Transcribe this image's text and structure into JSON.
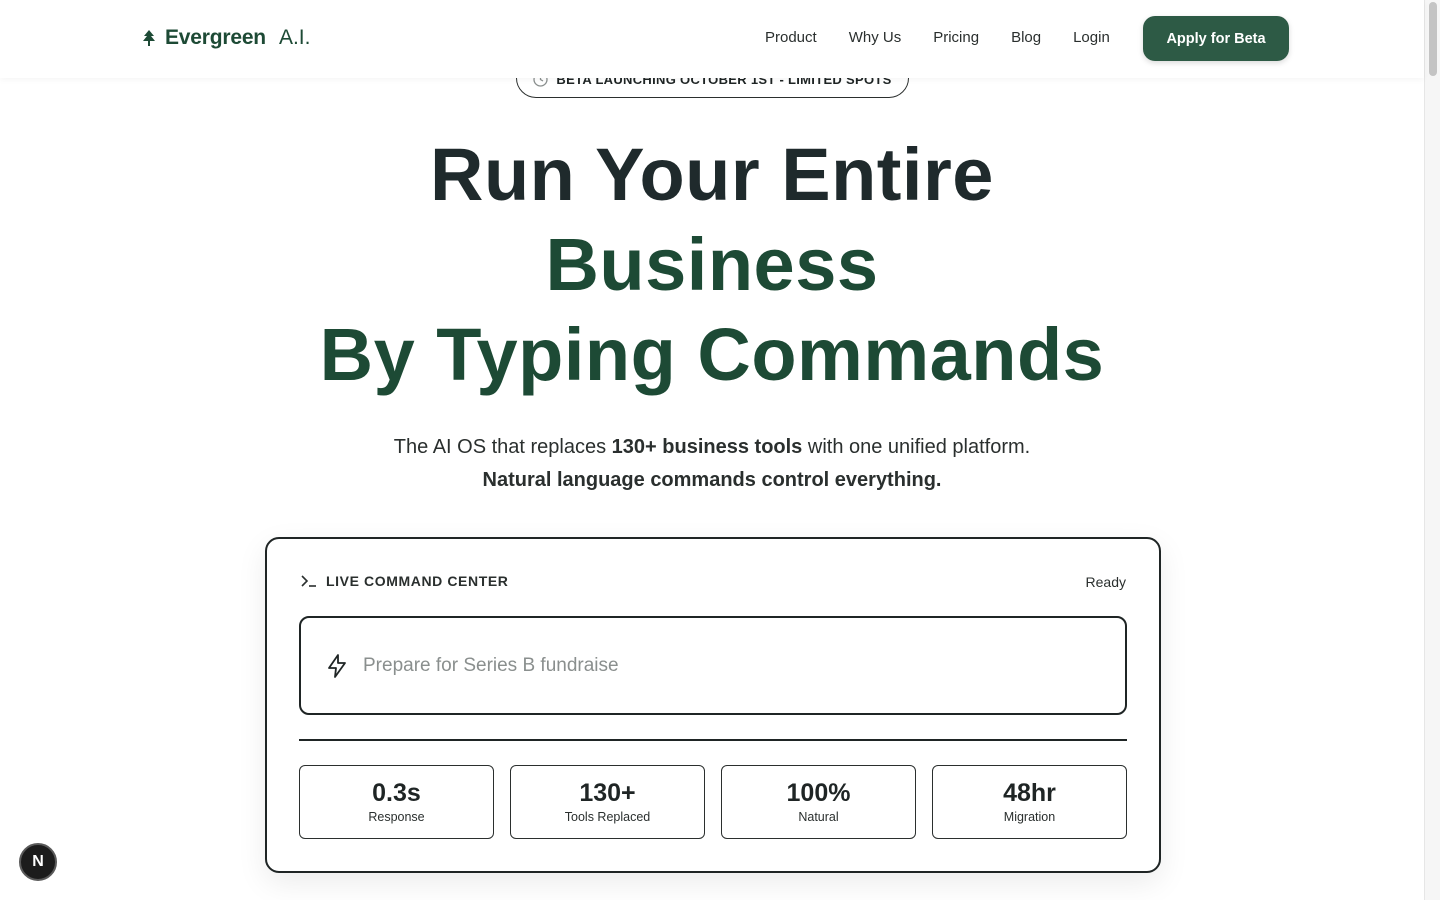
{
  "header": {
    "brand": "Evergreen",
    "brand_suffix": "A.I.",
    "nav": [
      "Product",
      "Why Us",
      "Pricing",
      "Blog",
      "Login"
    ],
    "cta": "Apply for Beta"
  },
  "beta_pill": "BETA LAUNCHING OCTOBER 1ST - LIMITED SPOTS",
  "hero": {
    "line1": "Run Your Entire",
    "line2": "Business",
    "line3": "By Typing Commands",
    "sub_prefix": "The AI OS that replaces ",
    "sub_bold": "130+ business tools",
    "sub_suffix": " with one unified platform.",
    "sub_line2": "Natural language commands control everything."
  },
  "command_center": {
    "title": "LIVE COMMAND CENTER",
    "status": "Ready",
    "placeholder": "Prepare for Series B fundraise",
    "stats": [
      {
        "value": "0.3s",
        "label": "Response"
      },
      {
        "value": "130+",
        "label": "Tools Replaced"
      },
      {
        "value": "100%",
        "label": "Natural"
      },
      {
        "value": "48hr",
        "label": "Migration"
      }
    ]
  },
  "badge": "N",
  "colors": {
    "brand_green": "#1d4a35",
    "button_green": "#2d5a45",
    "text_dark": "#1f2a2c"
  },
  "icons": [
    "tree-icon",
    "clock-icon",
    "terminal-icon",
    "lightning-icon"
  ]
}
